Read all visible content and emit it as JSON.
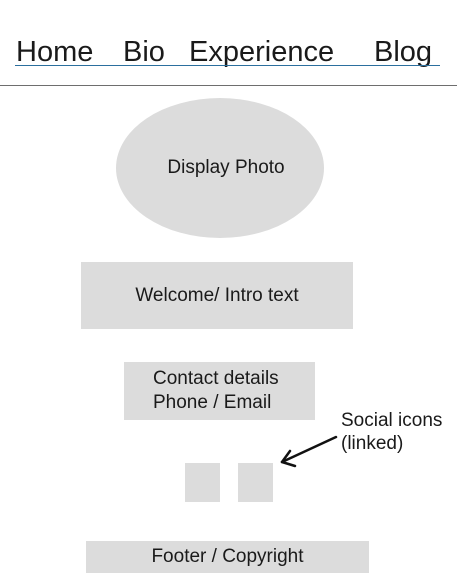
{
  "nav": {
    "items": [
      {
        "label": "Home"
      },
      {
        "label": "Bio"
      },
      {
        "label": "Experience"
      },
      {
        "label": "Blog"
      }
    ],
    "underline_color": "#2b6f9e"
  },
  "photo": {
    "label": "Display Photo"
  },
  "intro": {
    "label": "Welcome/ Intro text"
  },
  "contact": {
    "line1": "Contact details",
    "line2": "Phone / Email"
  },
  "social": {
    "annotation_line1": "Social icons",
    "annotation_line2": "(linked)"
  },
  "footer": {
    "label": "Footer / Copyright"
  },
  "colors": {
    "placeholder_fill": "#dcdcdc",
    "divider": "#6e6e6e"
  }
}
